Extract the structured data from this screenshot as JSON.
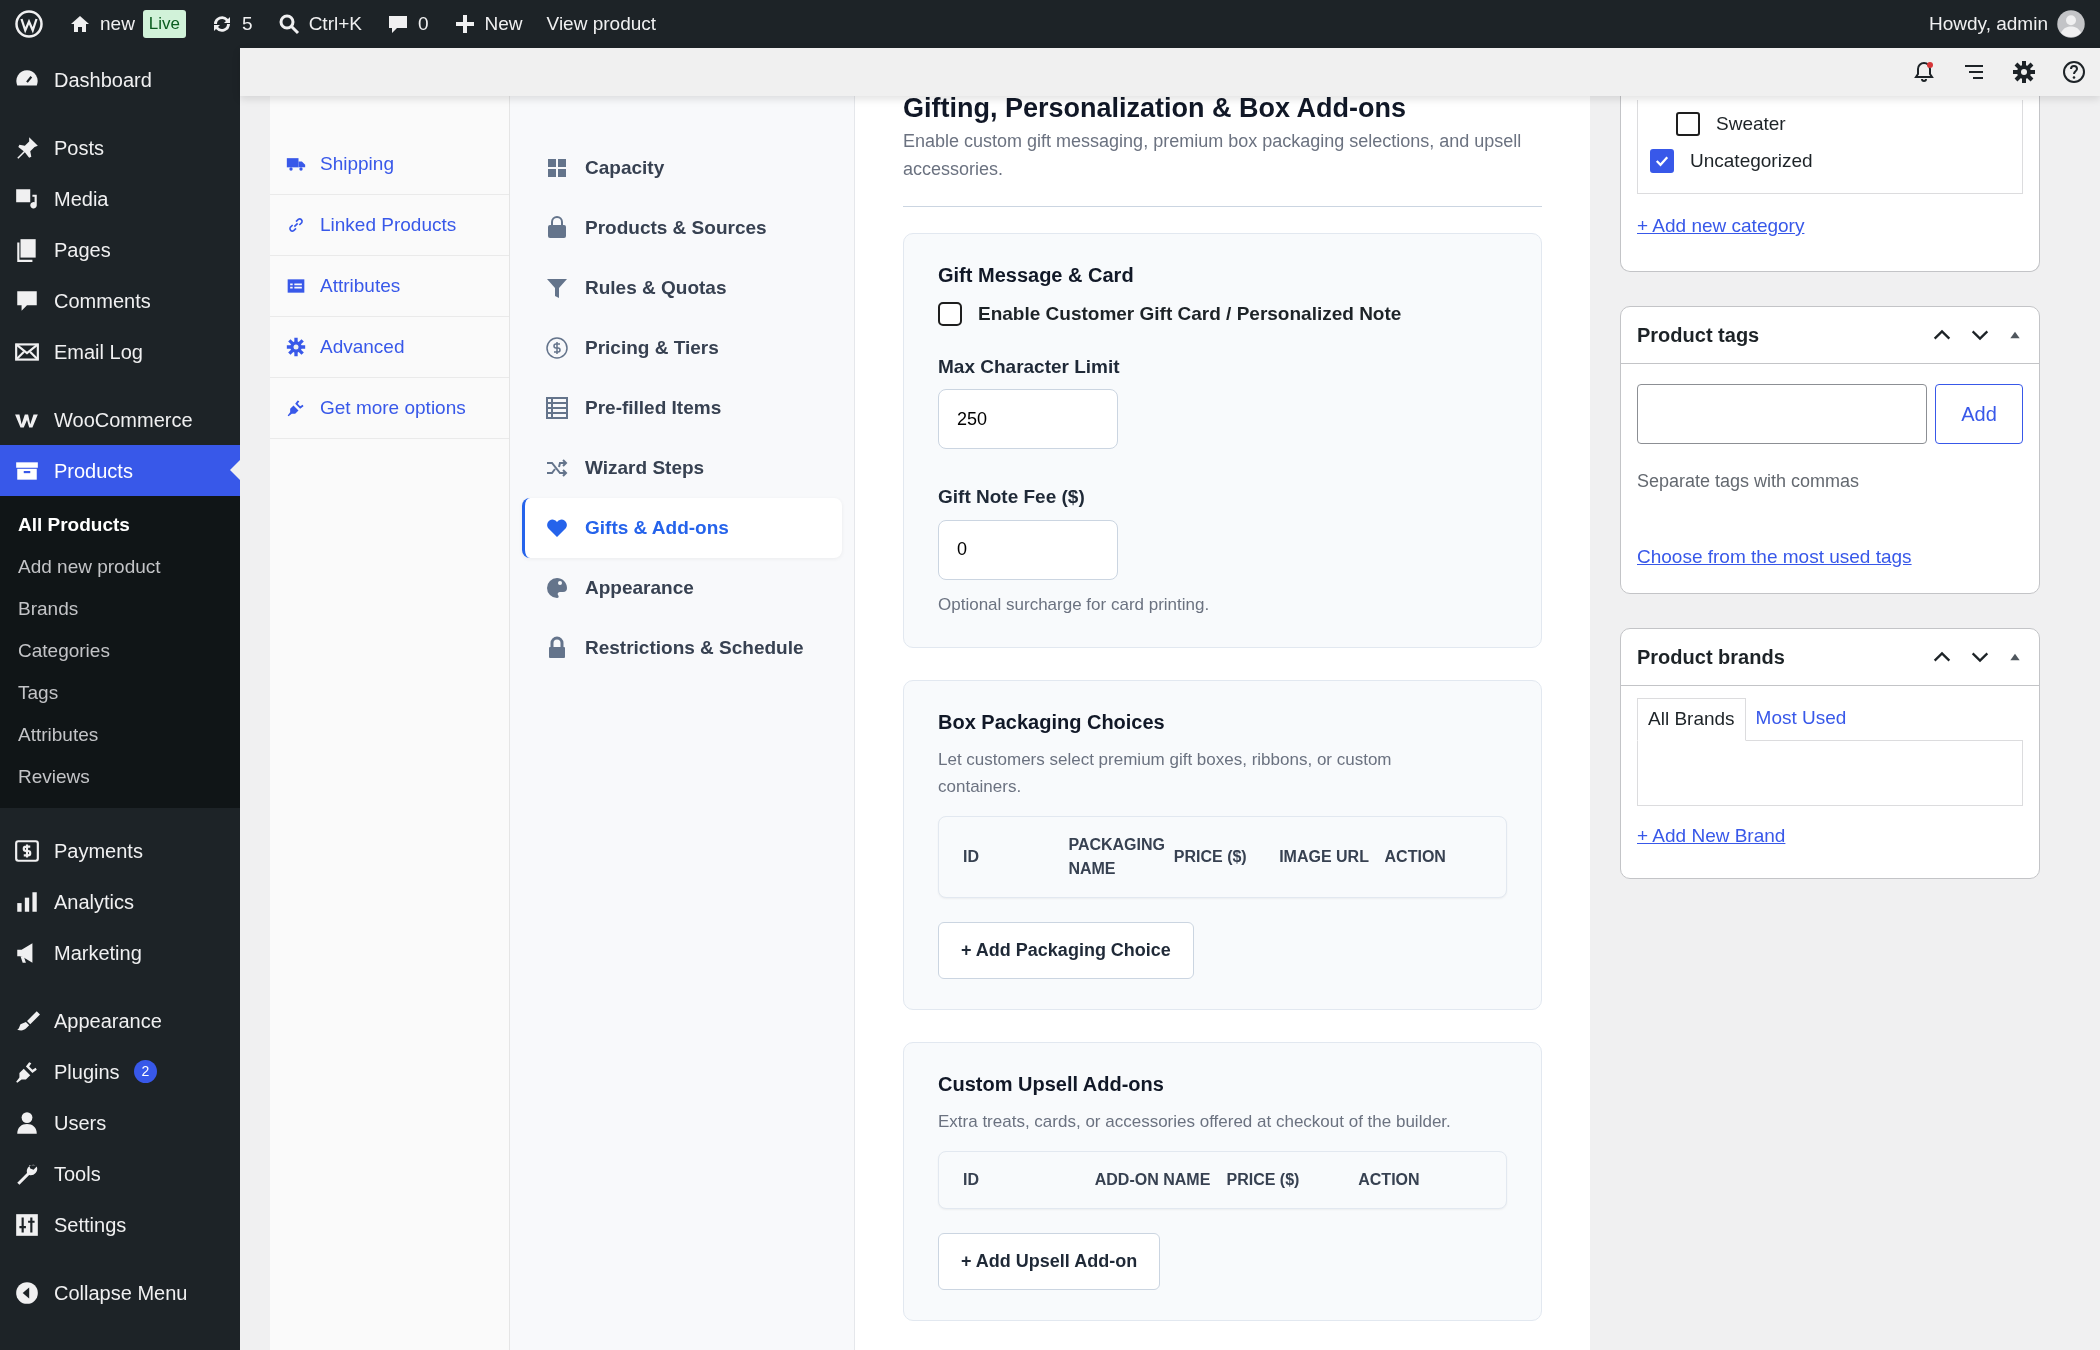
{
  "admin_bar": {
    "site": "new",
    "badge": "Live",
    "updates": "5",
    "search": "Ctrl+K",
    "comments": "0",
    "new_label": "New",
    "view_label": "View product",
    "greeting": "Howdy, admin"
  },
  "admin_menu": [
    [
      {
        "label": "Dashboard",
        "selected": false
      }
    ],
    [
      {
        "label": "Posts",
        "selected": false
      },
      {
        "label": "Media",
        "selected": false
      },
      {
        "label": "Pages",
        "selected": false
      },
      {
        "label": "Comments",
        "selected": false
      },
      {
        "label": "Email Log",
        "selected": false
      }
    ],
    [
      {
        "label": "WooCommerce",
        "selected": false
      },
      {
        "label": "Products",
        "selected": true,
        "submenu": [
          {
            "label": "All Products",
            "selected": true
          },
          {
            "label": "Add new product",
            "selected": false
          },
          {
            "label": "Brands",
            "selected": false
          },
          {
            "label": "Categories",
            "selected": false
          },
          {
            "label": "Tags",
            "selected": false
          },
          {
            "label": "Attributes",
            "selected": false
          },
          {
            "label": "Reviews",
            "selected": false
          }
        ]
      }
    ],
    [
      {
        "label": "Payments",
        "selected": false
      },
      {
        "label": "Analytics",
        "selected": false
      },
      {
        "label": "Marketing",
        "selected": false
      }
    ],
    [
      {
        "label": "Appearance",
        "selected": false
      },
      {
        "label": "Plugins",
        "selected": false,
        "badge": "2"
      },
      {
        "label": "Users",
        "selected": false
      },
      {
        "label": "Tools",
        "selected": false
      },
      {
        "label": "Settings",
        "selected": false
      }
    ],
    [
      {
        "label": "Collapse Menu",
        "selected": false
      }
    ]
  ],
  "toolbar": {
    "notification_alert": true
  },
  "product_tabs": [
    {
      "label": "Shipping",
      "selected": false
    },
    {
      "label": "Linked Products",
      "selected": false
    },
    {
      "label": "Attributes",
      "selected": false
    },
    {
      "label": "Advanced",
      "selected": false
    },
    {
      "label": "Get more options",
      "selected": false
    }
  ],
  "builder_nav": [
    {
      "label": "Capacity",
      "selected": false
    },
    {
      "label": "Products & Sources",
      "selected": false
    },
    {
      "label": "Rules & Quotas",
      "selected": false
    },
    {
      "label": "Pricing & Tiers",
      "selected": false
    },
    {
      "label": "Pre-filled Items",
      "selected": false
    },
    {
      "label": "Wizard Steps",
      "selected": false
    },
    {
      "label": "Gifts & Add-ons",
      "selected": true
    },
    {
      "label": "Appearance",
      "selected": false
    },
    {
      "label": "Restrictions & Schedule",
      "selected": false
    }
  ],
  "section": {
    "title": "Gifting, Personalization & Box Add-ons",
    "description": "Enable custom gift messaging, premium box packaging selections, and upsell accessories."
  },
  "cards": [
    {
      "kind": "form",
      "title": "Gift Message & Card",
      "checkbox": {
        "label": "Enable Customer Gift Card / Personalized Note",
        "checked": false
      },
      "fields": [
        {
          "label": "Max Character Limit",
          "value": "250"
        },
        {
          "label": "Gift Note Fee ($)",
          "value": "0",
          "help": "Optional surcharge for card printing."
        }
      ]
    },
    {
      "kind": "table",
      "title": "Box Packaging Choices",
      "description": "Let customers select premium gift boxes, ribbons, or custom containers.",
      "columns": [
        "ID",
        "PACKAGING NAME",
        "PRICE ($)",
        "IMAGE URL",
        "ACTION"
      ],
      "button": "+ Add Packaging Choice"
    },
    {
      "kind": "table",
      "title": "Custom Upsell Add-ons",
      "description": "Extra treats, cards, or accessories offered at checkout of the builder.",
      "columns": [
        "ID",
        "ADD-ON NAME",
        "PRICE ($)",
        "ACTION"
      ],
      "button": "+ Add Upsell Add-on"
    }
  ],
  "categories": {
    "items": [
      {
        "children": [
          {
            "label": "Sweater",
            "checked": false
          }
        ]
      },
      {
        "label": "Uncategorized",
        "checked": true
      }
    ],
    "add_link": "+ Add new category"
  },
  "tags_box": {
    "title": "Product tags",
    "button": "Add",
    "hint": "Separate tags with commas",
    "link": "Choose from the most used tags"
  },
  "brands_box": {
    "title": "Product brands",
    "tabs": [
      {
        "label": "All Brands",
        "selected": true
      },
      {
        "label": "Most Used",
        "selected": false
      }
    ],
    "link": "+ Add New Brand"
  }
}
